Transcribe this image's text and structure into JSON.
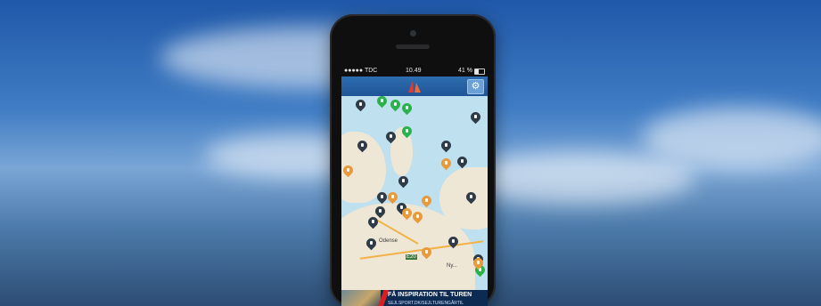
{
  "status_bar": {
    "carrier": "●●●●● TDC",
    "time": "10.49",
    "battery": "41 %",
    "battery_level": 0.41
  },
  "app_bar": {
    "logo": "app-logo-sails",
    "settings_icon": "gear-icon",
    "accent": "#1e5596"
  },
  "map": {
    "city_label": "Odense",
    "route_badge": "E20",
    "label_small": "Ny..."
  },
  "banner": {
    "headline": "FÅ INSPIRATION TIL TUREN",
    "url": "SEJLSPORT.DK/SEJLTURENGÅRTIL",
    "accent": "#d81f26"
  },
  "colors": {
    "pin_dark": "#2f3b47",
    "pin_green": "#2bb24c",
    "pin_orange": "#e89a3c",
    "sea": "#bfe0ef",
    "land": "#efe7d5"
  }
}
